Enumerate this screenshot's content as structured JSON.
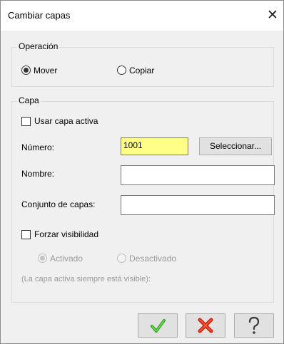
{
  "window": {
    "title": "Cambiar capas"
  },
  "operation": {
    "legend": "Operación",
    "options": [
      {
        "label": "Mover",
        "selected": true
      },
      {
        "label": "Copiar",
        "selected": false
      }
    ]
  },
  "layer": {
    "legend": "Capa",
    "use_active_label": "Usar capa activa",
    "use_active_checked": false,
    "number_label": "Número:",
    "number_value": "1001",
    "select_button": "Seleccionar...",
    "name_label": "Nombre:",
    "name_value": "",
    "layer_set_label": "Conjunto de capas:",
    "layer_set_value": "",
    "force_visibility_label": "Forzar visibilidad",
    "force_visibility_checked": false,
    "visibility_options": [
      {
        "label": "Activado",
        "selected": true,
        "enabled": false
      },
      {
        "label": "Desactivado",
        "selected": false,
        "enabled": false
      }
    ],
    "note": "(La capa activa siempre está visible):"
  },
  "footer": {
    "ok_icon": "checkmark-icon",
    "cancel_icon": "red-x-icon",
    "help_icon": "question-mark-icon"
  }
}
